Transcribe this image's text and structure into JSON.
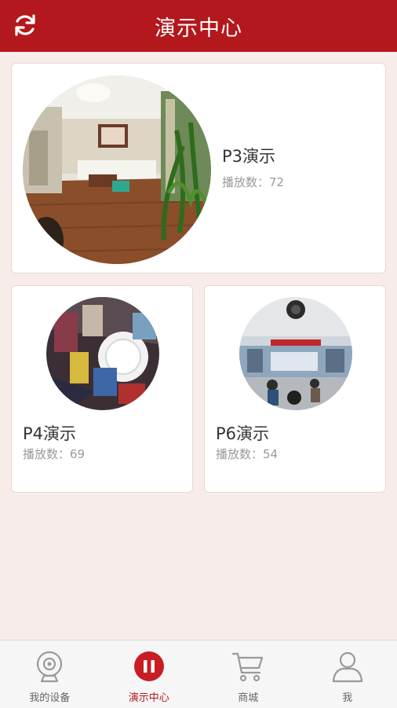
{
  "header": {
    "title": "演示中心",
    "refresh_icon": "refresh-icon"
  },
  "colors": {
    "brand": "#b3181d",
    "background": "#f7ecea"
  },
  "demos": [
    {
      "title": "P3演示",
      "plays": "播放数：72"
    },
    {
      "title": "P4演示",
      "plays": "播放数：69"
    },
    {
      "title": "P6演示",
      "plays": "播放数：54"
    }
  ],
  "tabs": [
    {
      "label": "我的设备",
      "icon": "camera-icon",
      "active": false
    },
    {
      "label": "演示中心",
      "icon": "pause-icon",
      "active": true
    },
    {
      "label": "商城",
      "icon": "cart-icon",
      "active": false
    },
    {
      "label": "我",
      "icon": "user-icon",
      "active": false
    }
  ]
}
